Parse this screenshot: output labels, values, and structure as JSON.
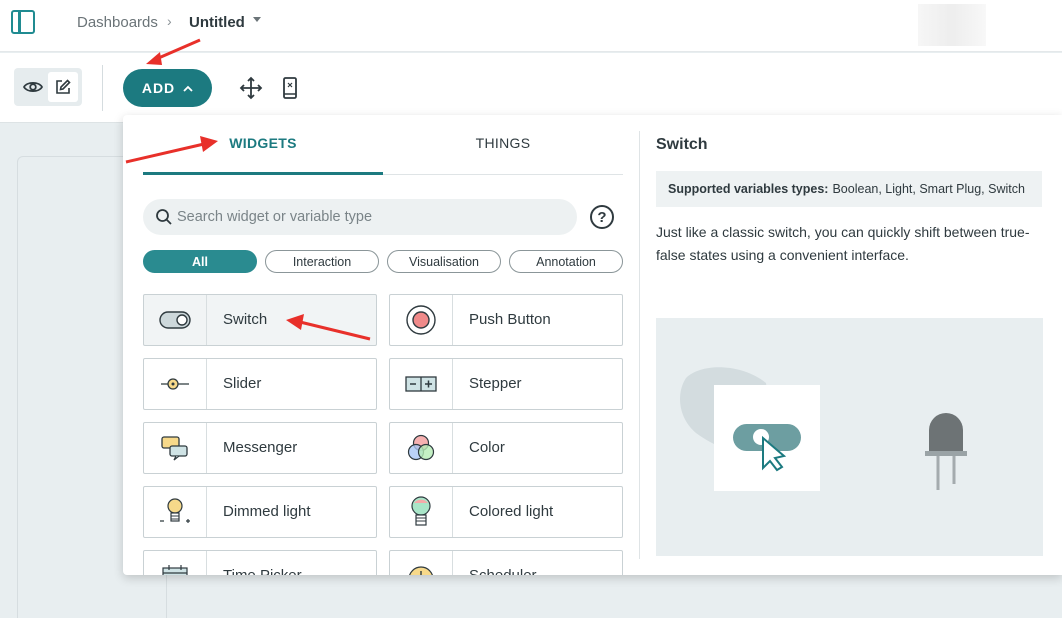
{
  "header": {
    "breadcrumb_root": "Dashboards",
    "breadcrumb_separator": "›",
    "dashboard_name": "Untitled"
  },
  "toolbar": {
    "add_label": "ADD",
    "icons": [
      "eye-icon",
      "edit-icon",
      "move-icon",
      "mobile-icon"
    ]
  },
  "tabs": [
    {
      "label": "WIDGETS",
      "active": true
    },
    {
      "label": "THINGS",
      "active": false
    }
  ],
  "search": {
    "placeholder": "Search widget or variable type",
    "value": ""
  },
  "help_label": "?",
  "filters": [
    {
      "label": "All",
      "active": true
    },
    {
      "label": "Interaction",
      "active": false
    },
    {
      "label": "Visualisation",
      "active": false
    },
    {
      "label": "Annotation",
      "active": false
    }
  ],
  "widgets": [
    {
      "label": "Switch",
      "icon": "switch-icon",
      "selected": true
    },
    {
      "label": "Push Button",
      "icon": "push-button-icon"
    },
    {
      "label": "Slider",
      "icon": "slider-icon"
    },
    {
      "label": "Stepper",
      "icon": "stepper-icon"
    },
    {
      "label": "Messenger",
      "icon": "messenger-icon"
    },
    {
      "label": "Color",
      "icon": "color-icon"
    },
    {
      "label": "Dimmed light",
      "icon": "dimmed-light-icon"
    },
    {
      "label": "Colored light",
      "icon": "colored-light-icon"
    },
    {
      "label": "Time Picker",
      "icon": "time-picker-icon"
    },
    {
      "label": "Scheduler",
      "icon": "scheduler-icon"
    }
  ],
  "detail": {
    "title": "Switch",
    "types_label": "Supported variables types:",
    "types_value": "Boolean, Light, Smart Plug, Switch",
    "description": "Just like a classic switch, you can quickly shift between true-false states using a convenient interface."
  },
  "colors": {
    "accent": "#1c7a80",
    "annotation_arrow": "#e8302a",
    "canvas": "#e8eef0"
  }
}
